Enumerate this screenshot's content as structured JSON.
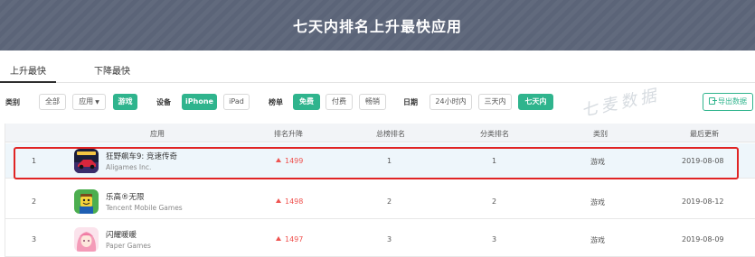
{
  "banner": {
    "title": "七天内排名上升最快应用"
  },
  "tabs": [
    {
      "label": "上升最快",
      "active": true
    },
    {
      "label": "下降最快",
      "active": false
    }
  ],
  "filters": {
    "category_label": "类别",
    "category_options": [
      "全部",
      "应用",
      "游戏"
    ],
    "category_selected": "游戏",
    "device_label": "设备",
    "device_options": [
      "iPhone",
      "iPad"
    ],
    "device_selected": "iPhone",
    "chart_label": "榜单",
    "chart_options": [
      "免费",
      "付费",
      "畅销"
    ],
    "chart_selected": "免费",
    "date_label": "日期",
    "date_options": [
      "24小时内",
      "三天内",
      "七天内"
    ],
    "date_selected": "七天内"
  },
  "export_label": "导出数据",
  "watermark": "七麦数据",
  "table": {
    "headers": [
      "应用",
      "排名升降",
      "总榜排名",
      "分类排名",
      "类别",
      "最后更新"
    ],
    "rows": [
      {
        "index": "1",
        "name": "狂野飙车9: 竞速传奇",
        "developer": "Aligames Inc.",
        "rank_change": "1499",
        "total_rank": "1",
        "category_rank": "1",
        "category": "游戏",
        "updated": "2019-08-08"
      },
      {
        "index": "2",
        "name": "乐高®无限",
        "developer": "Tencent Mobile Games",
        "rank_change": "1498",
        "total_rank": "2",
        "category_rank": "2",
        "category": "游戏",
        "updated": "2019-08-12"
      },
      {
        "index": "3",
        "name": "闪耀暖暖",
        "developer": "Paper Games",
        "rank_change": "1497",
        "total_rank": "3",
        "category_rank": "3",
        "category": "游戏",
        "updated": "2019-08-09"
      }
    ]
  },
  "colors": {
    "accent": "#2fb48d",
    "banner": "#5b6478",
    "up": "#ef5350",
    "highlight": "#e02424"
  }
}
